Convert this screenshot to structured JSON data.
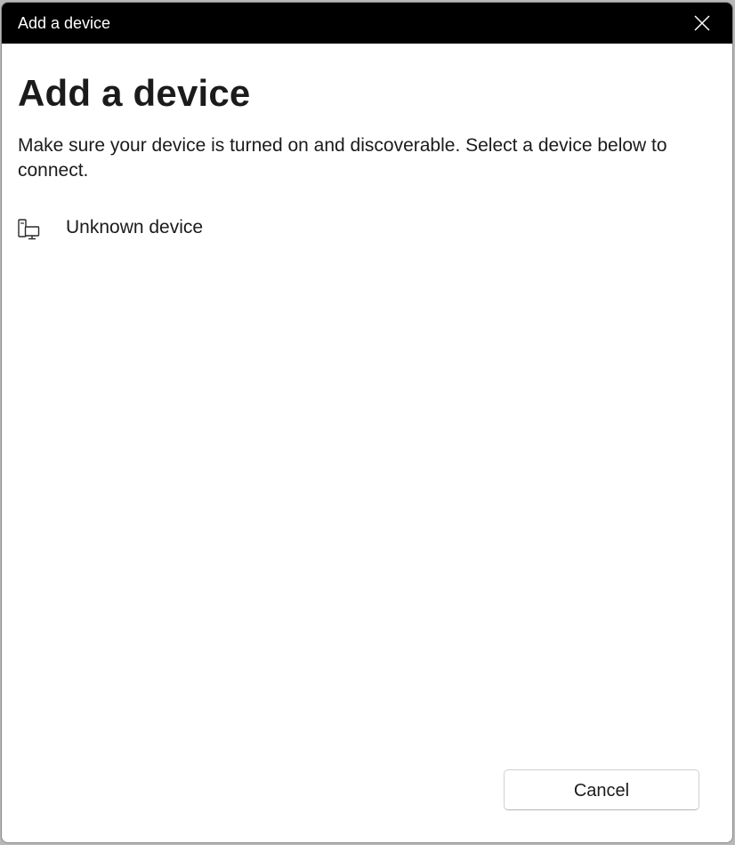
{
  "window": {
    "title": "Add a device",
    "close_icon": "close-icon"
  },
  "main": {
    "heading": "Add a device",
    "description": "Make sure your device is turned on and discoverable. Select a device below to connect.",
    "devices": [
      {
        "label": "Unknown device",
        "icon": "device-icon"
      }
    ]
  },
  "footer": {
    "cancel_label": "Cancel"
  },
  "colors": {
    "titlebar_bg": "#000000",
    "titlebar_text": "#ffffff",
    "content_bg": "#ffffff",
    "text": "#1b1b1b"
  }
}
